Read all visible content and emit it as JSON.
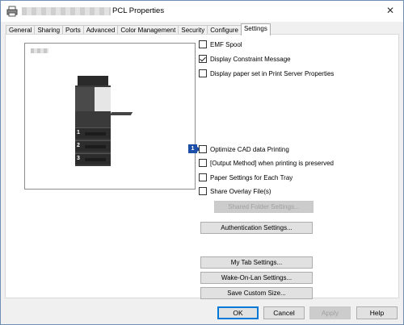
{
  "window": {
    "title": "PCL Properties",
    "close_glyph": "✕"
  },
  "tabs": [
    {
      "label": "General"
    },
    {
      "label": "Sharing"
    },
    {
      "label": "Ports"
    },
    {
      "label": "Advanced"
    },
    {
      "label": "Color Management"
    },
    {
      "label": "Security"
    },
    {
      "label": "Configure"
    },
    {
      "label": "Settings",
      "active": true
    }
  ],
  "preview": {
    "tray_labels": [
      "1",
      "2",
      "3"
    ],
    "badge": "1"
  },
  "options": [
    {
      "label": "EMF Spool",
      "checked": false
    },
    {
      "label": "Display Constraint Message",
      "checked": true
    },
    {
      "label": "Display paper set in Print Server Properties",
      "checked": false
    },
    {
      "label": "Optimize CAD data Printing",
      "checked": false
    },
    {
      "label": "[Output Method] when printing is preserved",
      "checked": false
    },
    {
      "label": "Paper Settings for Each Tray",
      "checked": false
    },
    {
      "label": "Share Overlay File(s)",
      "checked": false
    }
  ],
  "buttons": {
    "shared_folder": "Shared Folder Settings...",
    "authentication": "Authentication Settings...",
    "my_tab": "My Tab Settings...",
    "wake_on_lan": "Wake-On-Lan Settings...",
    "save_custom": "Save Custom Size..."
  },
  "footer": {
    "ok": "OK",
    "cancel": "Cancel",
    "apply": "Apply",
    "help": "Help"
  }
}
